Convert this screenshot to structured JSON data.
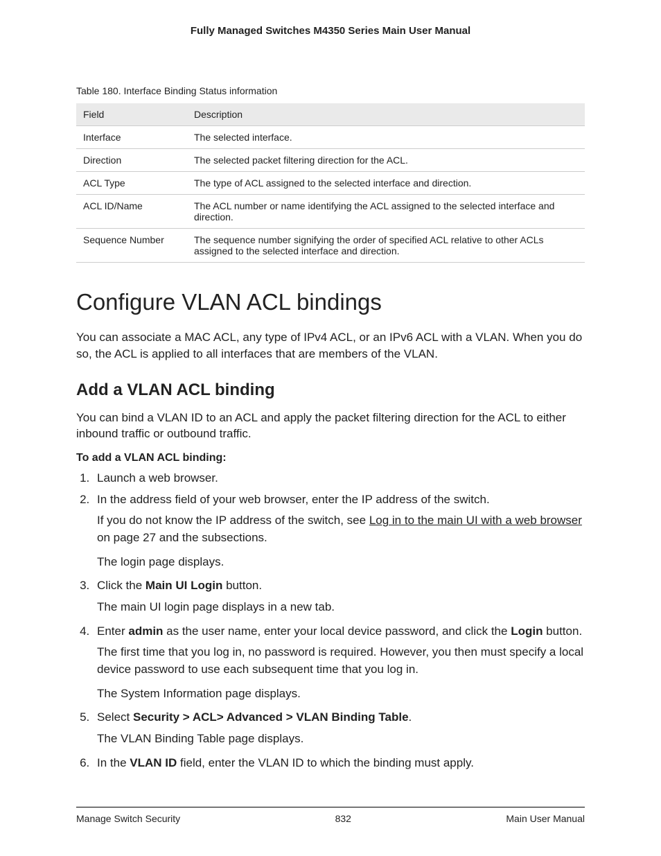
{
  "header": {
    "title": "Fully Managed Switches M4350 Series Main User Manual"
  },
  "table": {
    "caption": "Table 180. Interface Binding Status information",
    "headers": {
      "field": "Field",
      "description": "Description"
    },
    "rows": [
      {
        "field": "Interface",
        "description": "The selected interface."
      },
      {
        "field": "Direction",
        "description": "The selected packet filtering direction for the ACL."
      },
      {
        "field": "ACL Type",
        "description": "The type of ACL assigned to the selected interface and direction."
      },
      {
        "field": "ACL ID/Name",
        "description": "The ACL number or name identifying the ACL assigned to the selected interface and direction."
      },
      {
        "field": "Sequence Number",
        "description": "The sequence number signifying the order of specified ACL relative to other ACLs assigned to the selected interface and direction."
      }
    ]
  },
  "section": {
    "title": "Configure VLAN ACL bindings",
    "intro": "You can associate a MAC ACL, any type of IPv4 ACL, or an IPv6 ACL with a VLAN. When you do so, the ACL is applied to all interfaces that are members of the VLAN."
  },
  "subsection": {
    "title": "Add a VLAN ACL binding",
    "intro": "You can bind a VLAN ID to an ACL and apply the packet filtering direction for the ACL to either inbound traffic or outbound traffic.",
    "procedure_title": "To add a VLAN ACL binding:",
    "steps": {
      "s1": "Launch a web browser.",
      "s2": "In the address field of your web browser, enter the IP address of the switch.",
      "s2_a_pre": "If you do not know the IP address of the switch, see ",
      "s2_a_link": "Log in to the main UI with a web browser",
      "s2_a_post": " on page 27 and the subsections.",
      "s2_b": "The login page displays.",
      "s3_pre": "Click the ",
      "s3_bold": "Main UI Login",
      "s3_post": " button.",
      "s3_a": "The main UI login page displays in a new tab.",
      "s4_pre": "Enter ",
      "s4_bold1": "admin",
      "s4_mid": " as the user name, enter your local device password, and click the ",
      "s4_bold2": "Login",
      "s4_post": " button.",
      "s4_a": "The first time that you log in, no password is required. However, you then must specify a local device password to use each subsequent time that you log in.",
      "s4_b": "The System Information page displays.",
      "s5_pre": "Select ",
      "s5_bold": "Security > ACL> Advanced > VLAN Binding Table",
      "s5_post": ".",
      "s5_a": "The VLAN Binding Table page displays.",
      "s6_pre": "In the ",
      "s6_bold": "VLAN ID",
      "s6_post": " field, enter the VLAN ID to which the binding must apply."
    }
  },
  "footer": {
    "left": "Manage Switch Security",
    "center": "832",
    "right": "Main User Manual"
  }
}
